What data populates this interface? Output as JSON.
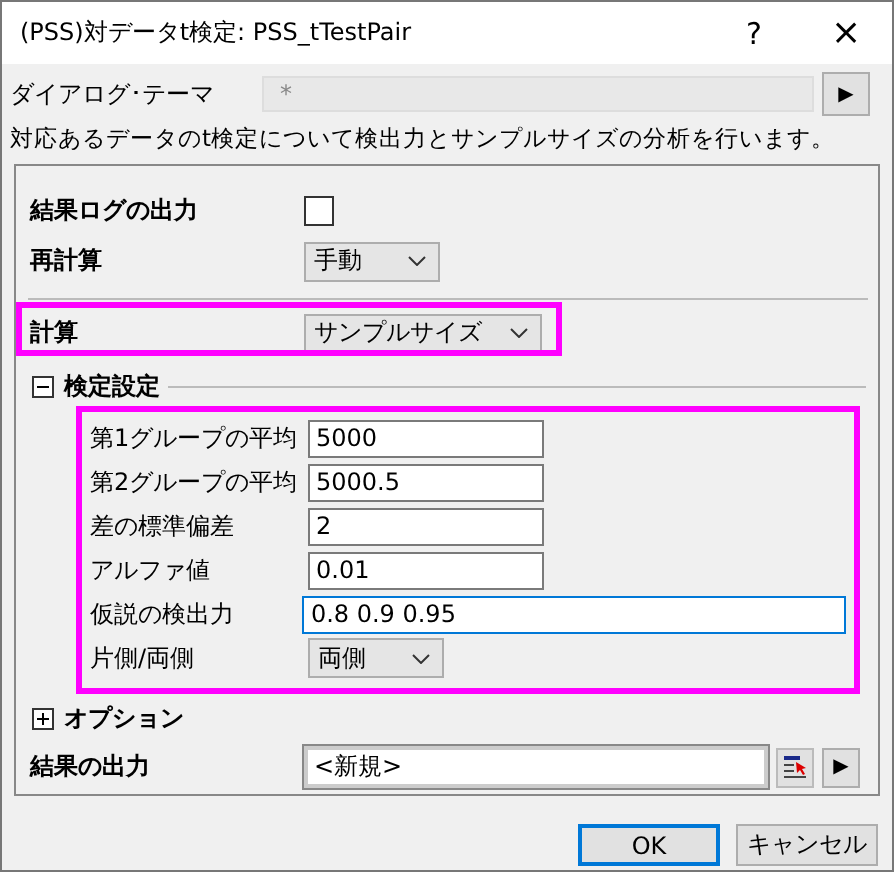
{
  "window": {
    "title": "(PSS)対データt検定: PSS_tTestPair",
    "help": "?",
    "close": "×"
  },
  "theme": {
    "label": "ダイアログ･テーマ",
    "value": "*",
    "button": "▶"
  },
  "description": "対応あるデータのt検定について検出力とサンプルサイズの分析を行います。",
  "top_settings": [
    {
      "kind": "checkbox",
      "label": "結果ログの出力",
      "checked": false,
      "highlighted": false
    },
    {
      "kind": "dropdown",
      "label": "再計算",
      "value": "手動",
      "highlighted": false
    },
    {
      "kind": "divider"
    },
    {
      "kind": "dropdown",
      "label": "計算",
      "value": "サンプルサイズ",
      "highlighted": true
    }
  ],
  "test_settings": {
    "title": "検定設定",
    "expanded": true,
    "highlighted": true,
    "rows": [
      {
        "kind": "text",
        "label": "第1グループの平均",
        "value": "5000",
        "focused": false
      },
      {
        "kind": "text",
        "label": "第2グループの平均",
        "value": "5000.5",
        "focused": false
      },
      {
        "kind": "text",
        "label": "差の標準偏差",
        "value": "2",
        "focused": false
      },
      {
        "kind": "text",
        "label": "アルファ値",
        "value": "0.01",
        "focused": false
      },
      {
        "kind": "text",
        "label": "仮説の検出力",
        "value": "0.8 0.9 0.95",
        "focused": true
      },
      {
        "kind": "dropdown",
        "label": "片側/両側",
        "value": "両側"
      }
    ]
  },
  "options": {
    "title": "オプション",
    "expanded": false
  },
  "output": {
    "label": "結果の出力",
    "value": "<新規>",
    "button": "▶"
  },
  "buttons": [
    {
      "label": "OK",
      "default": true
    },
    {
      "label": "キャンセル",
      "default": false
    }
  ]
}
